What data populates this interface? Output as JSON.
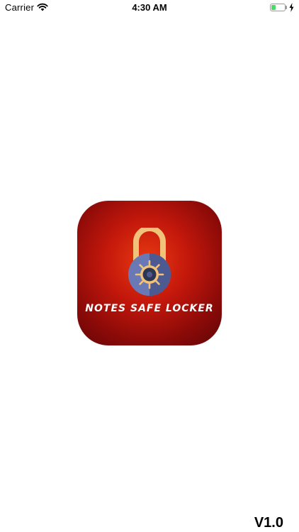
{
  "status_bar": {
    "carrier": "Carrier",
    "time": "4:30 AM",
    "battery_level": 0.28,
    "icons": [
      "wifi-icon",
      "battery-icon",
      "charging-bolt-icon"
    ]
  },
  "splash": {
    "app_name": "NOTES SAFE LOCKER",
    "icon": "padlock-icon",
    "version": "V1.0"
  },
  "colors": {
    "icon_background": "#c2170b",
    "shackle": "#f1c27a",
    "lock_body": "#6a79b5",
    "battery_fill": "#4cd964"
  }
}
